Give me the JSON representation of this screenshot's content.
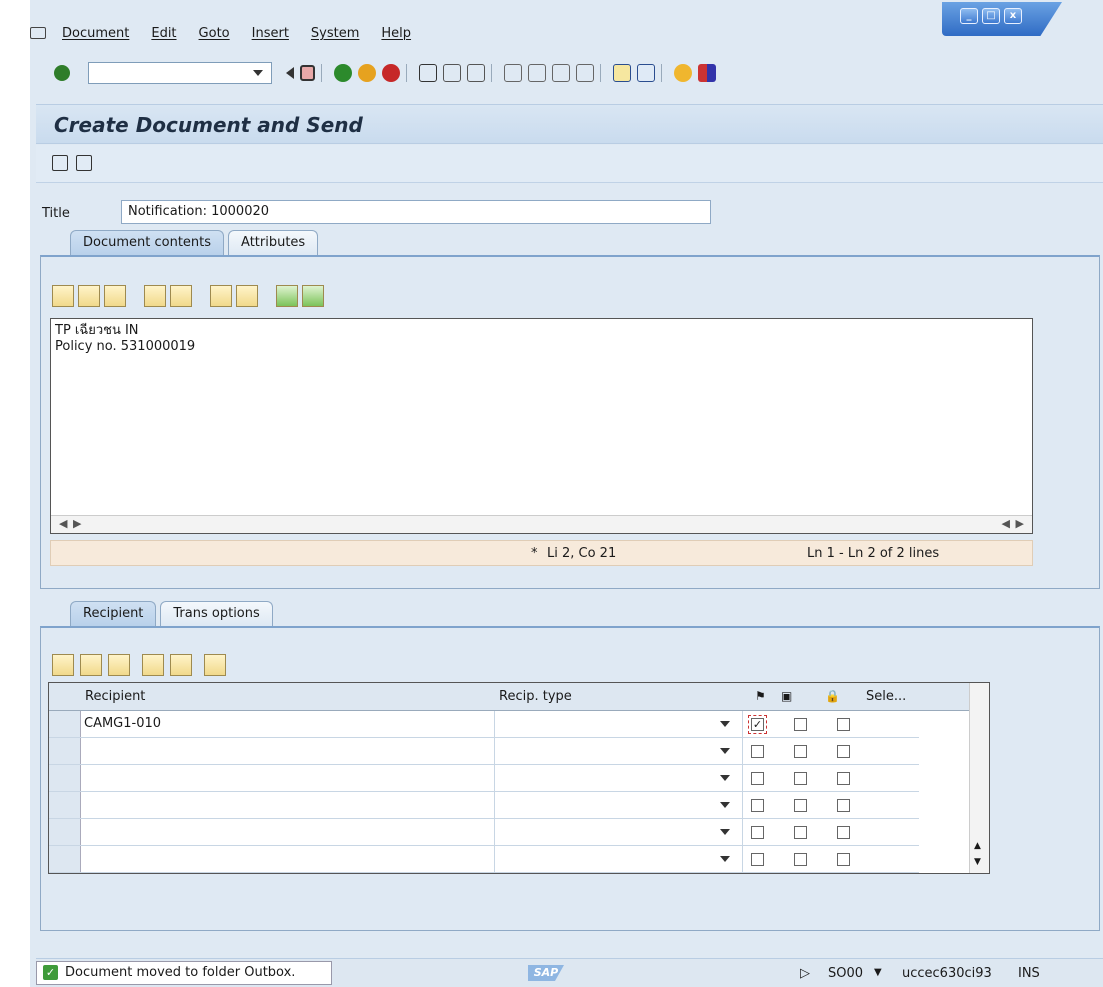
{
  "menu": [
    "Document",
    "Edit",
    "Goto",
    "Insert",
    "System",
    "Help"
  ],
  "window_controls": [
    "_",
    "□",
    "x"
  ],
  "page": {
    "title": "Create Document and Send"
  },
  "title_field": {
    "label": "Title",
    "value": "Notification: 1000020"
  },
  "doc_tabs": [
    "Document contents",
    "Attributes"
  ],
  "editor": {
    "lines": [
      "TP เฉียวชน IN",
      "Policy no. 531000019"
    ],
    "cursor": "Li 2, Co 21",
    "cursor_marker": "*",
    "line_range": "Ln 1 - Ln 2 of 2 lines"
  },
  "recipient_tabs": [
    "Recipient",
    "Trans options"
  ],
  "grid": {
    "headers": {
      "recipient": "Recipient",
      "recip_type": "Recip. type",
      "select": "Sele..."
    },
    "rows": [
      {
        "recipient": "CAMG1-010",
        "recip_type": "",
        "checked": true
      },
      {
        "recipient": "",
        "recip_type": "",
        "checked": false
      },
      {
        "recipient": "",
        "recip_type": "",
        "checked": false
      },
      {
        "recipient": "",
        "recip_type": "",
        "checked": false
      },
      {
        "recipient": "",
        "recip_type": "",
        "checked": false
      },
      {
        "recipient": "",
        "recip_type": "",
        "checked": false
      }
    ]
  },
  "status": {
    "message": "Document moved to folder Outbox.",
    "logo": "SAP",
    "transaction": "SO00",
    "server": "uccec630ci93",
    "mode": "INS"
  },
  "colors": {
    "accent": "#7fa3cc",
    "ok": "#3f9b3a"
  }
}
